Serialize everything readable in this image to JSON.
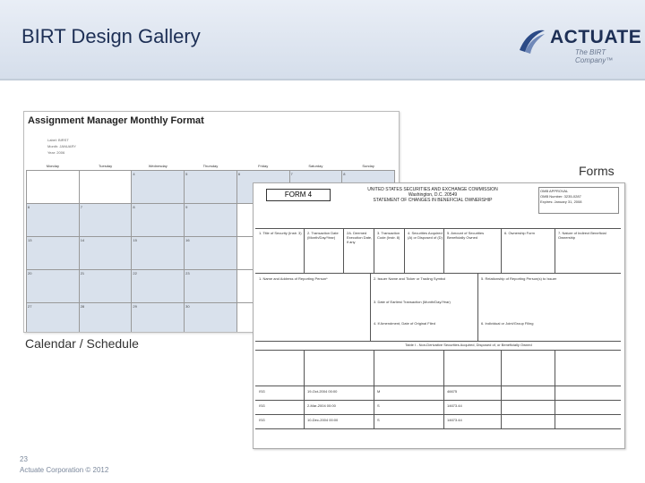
{
  "slide": {
    "title": "BIRT Design Gallery",
    "logo": {
      "word": "ACTUATE",
      "tagline": "The BIRT Company™"
    },
    "captions": {
      "forms": "Forms",
      "calendar": "Calendar / Schedule"
    },
    "footer": {
      "page_number": "23",
      "copyright": "Actuate Corporation © 2012"
    }
  },
  "calendar_doc": {
    "title": "Assignment Manager Monthly Format",
    "meta": [
      "Label: BIRST",
      "Month: JANUARY",
      "Year: 2006"
    ],
    "days": [
      "Monday",
      "Tuesday",
      "Wednesday",
      "Thursday",
      "Friday",
      "Saturday",
      "Sunday"
    ],
    "rows": [
      [
        "",
        "",
        "4",
        "5",
        "6",
        "7",
        "8"
      ],
      [
        "6",
        "7",
        "8",
        "9",
        "",
        "",
        ""
      ],
      [
        "13",
        "14",
        "15",
        "16",
        "",
        "",
        ""
      ],
      [
        "20",
        "21",
        "22",
        "23",
        "",
        "",
        ""
      ],
      [
        "27",
        "28",
        "29",
        "30",
        "",
        "",
        ""
      ]
    ]
  },
  "form_doc": {
    "tag": "FORM 4",
    "heading": [
      "UNITED STATES SECURITIES AND EXCHANGE COMMISSION",
      "Washington, D.C. 20549",
      "STATEMENT OF CHANGES IN BENEFICIAL OWNERSHIP"
    ],
    "corner_box": [
      "OMB APPROVAL",
      "OMB Number: 3235-0287",
      "Expires: January 31, 2008"
    ],
    "sections": [
      "1. Title of Security (Instr. 3)",
      "2. Transaction Date (Month/Day/Year)",
      "2A. Deemed Execution Date, if any",
      "3. Transaction Code (Instr. 8)",
      "4. Securities Acquired (A) or Disposed of (D)",
      "5. Amount of Securities Beneficially Owned",
      "6. Ownership Form",
      "7. Nature of Indirect Beneficial Ownership"
    ],
    "reporting": [
      "1. Name and Address of Reporting Person*",
      "2. Issuer Name and Ticker or Trading Symbol",
      "5. Relationship of Reporting Person(s) to Issuer",
      "3. Date of Earliest Transaction (Month/Day/Year)",
      "4. If Amendment, Date of Original Filed",
      "6. Individual or Joint/Group Filing"
    ],
    "table_caption": "Table I - Non-Derivative Securities Acquired, Disposed of, or Beneficially Owned",
    "data_rows": [
      [
        "ISG",
        "19-Oct-2004 00:00",
        "M",
        "46675"
      ],
      [
        "ISG",
        "2-Mar-2004 00:00",
        "S",
        "14673.44"
      ],
      [
        "ISG",
        "10-Dec-2004 00:00",
        "S",
        "14673.44"
      ]
    ]
  }
}
